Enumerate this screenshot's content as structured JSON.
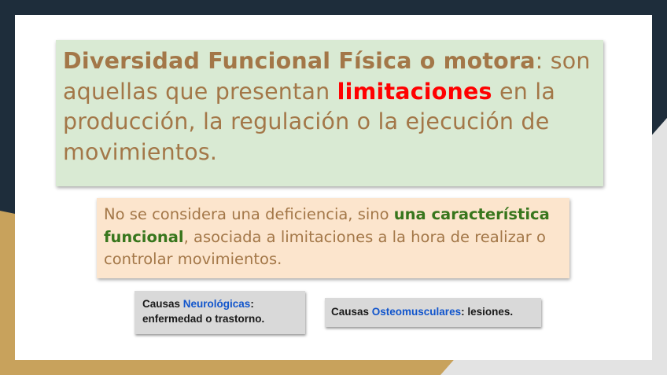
{
  "main_box": {
    "term": "Diversidad Funcional Física o motora",
    "text_before": ": son aquellas que presentan ",
    "highlight": "limitaciones",
    "text_after": " en la producción, la regulación o la ejecución de movimientos."
  },
  "note_box": {
    "text_before": "No se considera una deficiencia, sino ",
    "highlight": "una característica funcional",
    "text_after": ", asociada a limitaciones a la hora de realizar o controlar movimientos."
  },
  "causes": [
    {
      "prefix": "Causas ",
      "type": "Neurológicas",
      "suffix": ": enfermedad o trastorno."
    },
    {
      "prefix": "Causas ",
      "type": "Osteomusculares",
      "suffix": ": lesiones."
    }
  ],
  "colors": {
    "background": "#1e2d3b",
    "accent_gold": "#c8a25c",
    "main_box_bg": "#d9ead3",
    "note_box_bg": "#fce5cd",
    "cause_box_bg": "#d9d9d9",
    "text_brown": "#a37748",
    "highlight_red": "#ff0000",
    "highlight_green": "#38761d",
    "link_blue": "#1155cc"
  }
}
